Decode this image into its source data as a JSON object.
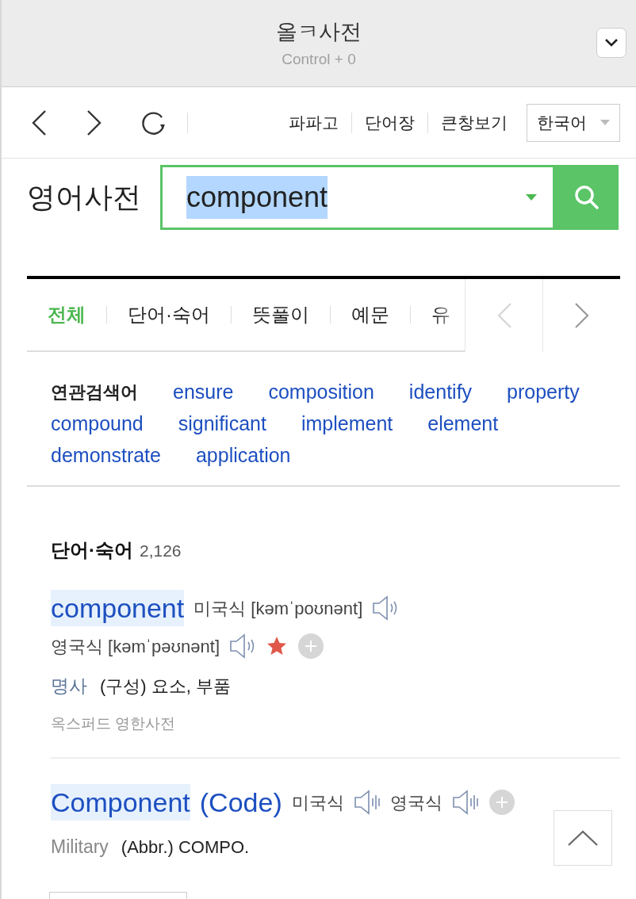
{
  "window": {
    "title": "올ㅋ사전",
    "shortcut": "Control + 0"
  },
  "toolbar": {
    "links": [
      "파파고",
      "단어장",
      "큰창보기"
    ],
    "language": "한국어"
  },
  "search": {
    "label": "영어사전",
    "value": "component",
    "selected": true
  },
  "tabs": [
    {
      "label": "전체",
      "selected": true
    },
    {
      "label": "단어·숙어",
      "selected": false
    },
    {
      "label": "뜻풀이",
      "selected": false
    },
    {
      "label": "예문",
      "selected": false
    },
    {
      "label": "유",
      "selected": false
    }
  ],
  "related": {
    "label": "연관검색어",
    "terms": [
      "ensure",
      "composition",
      "identify",
      "property",
      "compound",
      "significant",
      "implement",
      "element",
      "demonstrate",
      "application"
    ]
  },
  "section": {
    "title": "단어·숙어",
    "count": "2,126"
  },
  "entries": [
    {
      "headword": [
        {
          "text": "component",
          "highlighted": true
        }
      ],
      "pronunciations": [
        {
          "label": "미국식",
          "ipa": "[kəmˈpoʊnənt]"
        },
        {
          "label": "영국식",
          "ipa": "[kəmˈpəʊnənt]"
        }
      ],
      "starred": true,
      "senses": [
        {
          "pos": "명사",
          "meaning": "(구성) 요소, 부품"
        }
      ],
      "source": "옥스퍼드 영한사전"
    },
    {
      "headword": [
        {
          "text": "Component",
          "highlighted": true
        },
        {
          "text": "(Code)",
          "highlighted": false
        }
      ],
      "pronunciations": [
        {
          "label": "미국식"
        },
        {
          "label": "영국식"
        }
      ],
      "senses": [
        {
          "pos": "Military",
          "meaning": "(Abbr.) COMPO."
        }
      ]
    }
  ]
}
